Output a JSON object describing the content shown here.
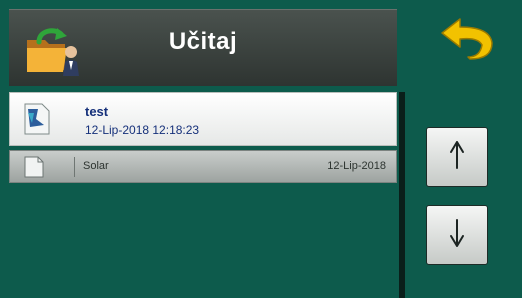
{
  "header": {
    "title": "Učitaj",
    "icon": "load-folder-icon"
  },
  "toolbar": {
    "back_icon": "back-arrow-icon",
    "up_icon": "arrow-up-icon",
    "down_icon": "arrow-down-icon"
  },
  "files": [
    {
      "name": "test",
      "date": "12-Lip-2018 12:18:23",
      "selected": true,
      "icon": "file-icon"
    },
    {
      "name": "Solar",
      "date": "12-Lip-2018",
      "selected": false,
      "icon": "file-icon"
    }
  ],
  "colors": {
    "background": "#0d5b4c",
    "header": "#3a413e",
    "selected_text": "#15307a",
    "back_arrow": "#f2c200"
  }
}
